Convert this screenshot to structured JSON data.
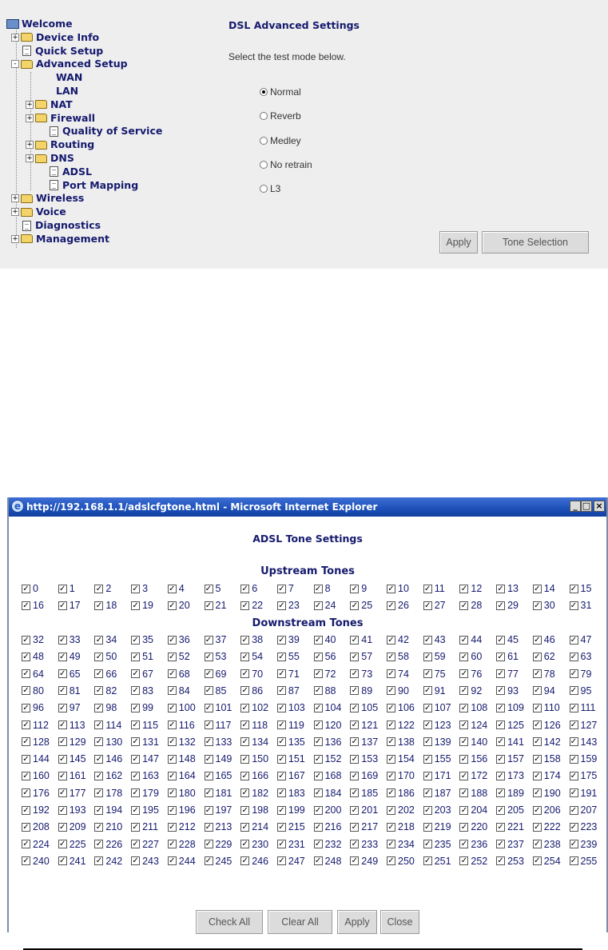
{
  "tree": {
    "items": [
      {
        "label": "Welcome",
        "icon": "computer-icon",
        "toggle": ""
      },
      {
        "label": "Device Info",
        "icon": "folder-icon",
        "toggle": "+"
      },
      {
        "label": "Quick Setup",
        "icon": "page-icon",
        "toggle": ""
      },
      {
        "label": "Advanced Setup",
        "icon": "folder-open-icon",
        "toggle": "-"
      },
      {
        "label": "WAN",
        "icon": "",
        "toggle": ""
      },
      {
        "label": "LAN",
        "icon": "",
        "toggle": ""
      },
      {
        "label": "NAT",
        "icon": "folder-icon",
        "toggle": "+"
      },
      {
        "label": "Firewall",
        "icon": "folder-icon",
        "toggle": "+"
      },
      {
        "label": "Quality of Service",
        "icon": "page-icon",
        "toggle": ""
      },
      {
        "label": "Routing",
        "icon": "folder-icon",
        "toggle": "+"
      },
      {
        "label": "DNS",
        "icon": "folder-icon",
        "toggle": "+"
      },
      {
        "label": "ADSL",
        "icon": "page-icon",
        "toggle": ""
      },
      {
        "label": "Port Mapping",
        "icon": "page-icon",
        "toggle": ""
      },
      {
        "label": "Wireless",
        "icon": "folder-icon",
        "toggle": "+"
      },
      {
        "label": "Voice",
        "icon": "folder-icon",
        "toggle": "+"
      },
      {
        "label": "Diagnostics",
        "icon": "page-icon",
        "toggle": ""
      },
      {
        "label": "Management",
        "icon": "folder-icon",
        "toggle": "+"
      }
    ]
  },
  "settings": {
    "title": "DSL Advanced Settings",
    "description": "Select the test mode below.",
    "modes": [
      {
        "label": "Normal",
        "selected": true
      },
      {
        "label": "Reverb",
        "selected": false
      },
      {
        "label": "Medley",
        "selected": false
      },
      {
        "label": "No retrain",
        "selected": false
      },
      {
        "label": "L3",
        "selected": false
      }
    ],
    "apply_label": "Apply",
    "tone_selection_label": "Tone Selection"
  },
  "popup": {
    "window_title": "http://192.168.1.1/adslcfgtone.html - Microsoft Internet Explorer",
    "minimize": "_",
    "maximize": "□",
    "close": "×",
    "heading": "ADSL Tone Settings",
    "upstream_title": "Upstream Tones",
    "downstream_title": "Downstream Tones",
    "upstream_range": [
      0,
      31
    ],
    "downstream_range": [
      32,
      255
    ],
    "all_checked": true,
    "check_all_label": "Check All",
    "clear_all_label": "Clear All",
    "apply_label": "Apply",
    "close_label": "Close"
  },
  "colors": {
    "text_blue": "#151a6e",
    "panel_bg": "#eeeeee",
    "title_bar": "#1c4fb8"
  }
}
